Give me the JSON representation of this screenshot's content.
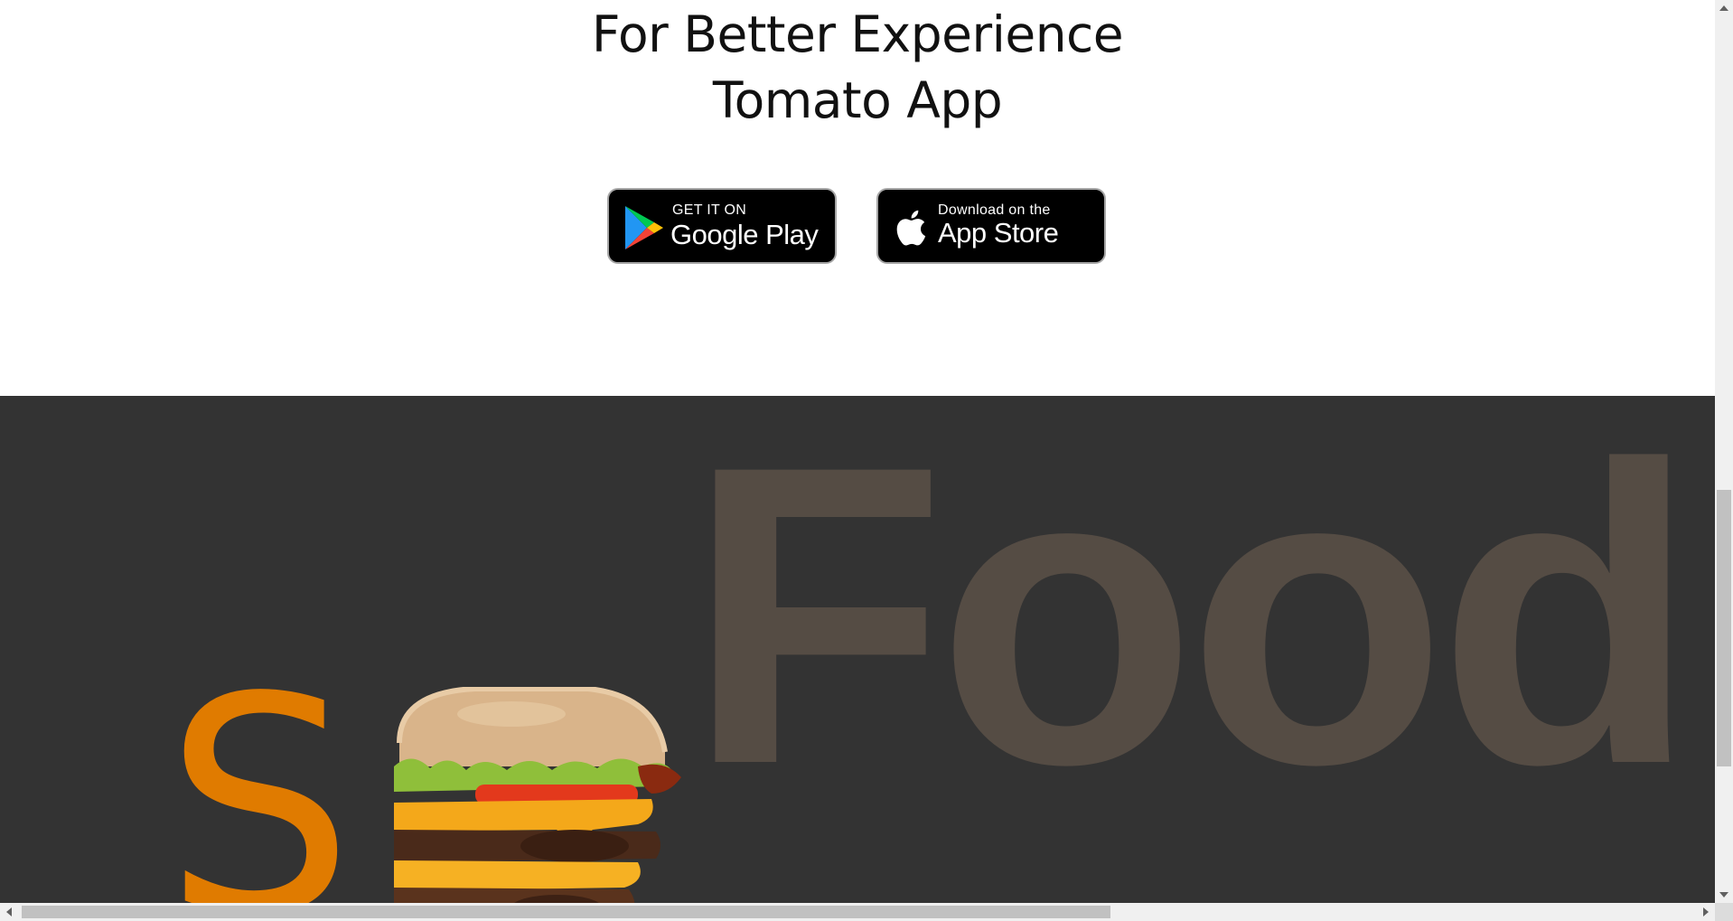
{
  "app_download": {
    "title_line1": "For Better Experience",
    "title_line2": "Tomato App",
    "google_play": {
      "small_text": "GET IT ON",
      "big_text": "Google Play",
      "icon": "google-play-icon"
    },
    "app_store": {
      "small_text": "Download on the",
      "big_text": "App Store",
      "icon": "apple-icon"
    }
  },
  "hero": {
    "word": "Food",
    "accent_letter": "S",
    "image": "burger-image"
  },
  "colors": {
    "hero_background": "#333333",
    "hero_word": "#554c44",
    "accent": "#e07b00",
    "badge_background": "#000000"
  },
  "scrollbars": {
    "vertical": "scrollbar-vertical",
    "horizontal": "scrollbar-horizontal"
  }
}
